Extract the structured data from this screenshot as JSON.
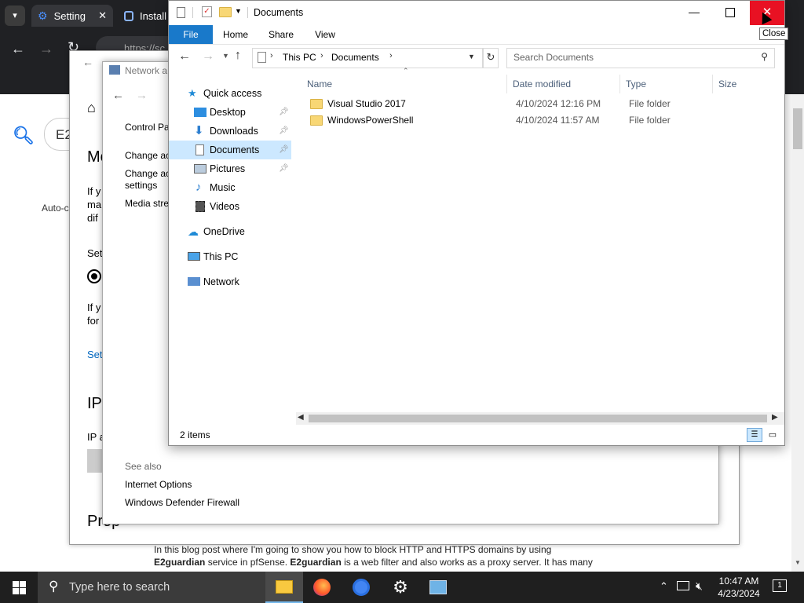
{
  "browser": {
    "tabs": [
      {
        "label": "Setting",
        "icon": "gear-icon"
      },
      {
        "label": "Install",
        "icon": "page-icon"
      }
    ],
    "url_partial": "https://sc",
    "search_partial": "E2",
    "autocomplete_partial": "Auto-c",
    "article_text_line1": "In this blog post where I'm going to show you how to block HTTP and HTTPS domains by using",
    "article_text_line2_bold1": "E2guardian",
    "article_text_line2_mid": " service in pfSense. ",
    "article_text_line2_bold2": "E2guardian",
    "article_text_line2_end": " is a web filter and also works as a proxy server. It has many"
  },
  "settings_window": {
    "heading_partial": "Mo",
    "para1": [
      "If y",
      "ma",
      "dif"
    ],
    "set_label": "Set",
    "para2": [
      "If y",
      "for"
    ],
    "link": "Set",
    "ip_heading": "IP",
    "ip_label": "IP a",
    "prop_heading": "Prop"
  },
  "control_panel": {
    "title": "Network a",
    "side_links": [
      "Control Pa",
      "Change ac",
      "Change ac",
      "settings",
      "Media stre"
    ],
    "see_also": "See also",
    "see_also_links": [
      "Internet Options",
      "Windows Defender Firewall"
    ]
  },
  "explorer": {
    "title": "Documents",
    "ribbon_tabs": [
      "File",
      "Home",
      "Share",
      "View"
    ],
    "breadcrumb": [
      "This PC",
      "Documents"
    ],
    "search_placeholder": "Search Documents",
    "nav": {
      "quick_access": "Quick access",
      "pinned": [
        {
          "label": "Desktop",
          "icon": "desktop-icon",
          "pinned": true
        },
        {
          "label": "Downloads",
          "icon": "download-icon",
          "pinned": true
        },
        {
          "label": "Documents",
          "icon": "documents-icon",
          "pinned": true,
          "selected": true
        },
        {
          "label": "Pictures",
          "icon": "pictures-icon",
          "pinned": true
        },
        {
          "label": "Music",
          "icon": "music-icon",
          "pinned": false
        },
        {
          "label": "Videos",
          "icon": "videos-icon",
          "pinned": false
        }
      ],
      "onedrive": "OneDrive",
      "this_pc": "This PC",
      "network": "Network"
    },
    "columns": [
      "Name",
      "Date modified",
      "Type",
      "Size"
    ],
    "files": [
      {
        "name": "Visual Studio 2017",
        "date": "4/10/2024 12:16 PM",
        "type": "File folder",
        "size": ""
      },
      {
        "name": "WindowsPowerShell",
        "date": "4/10/2024 11:57 AM",
        "type": "File folder",
        "size": ""
      }
    ],
    "status": "2 items",
    "tooltip": "Close"
  },
  "taskbar": {
    "search_placeholder": "Type here to search",
    "time": "10:47 AM",
    "date": "4/23/2024",
    "notification_count": "1"
  },
  "colors": {
    "accent": "#0063b1",
    "close_hover": "#e81123",
    "selected_bg": "#cce8ff",
    "taskbar": "#1f1f1f"
  }
}
